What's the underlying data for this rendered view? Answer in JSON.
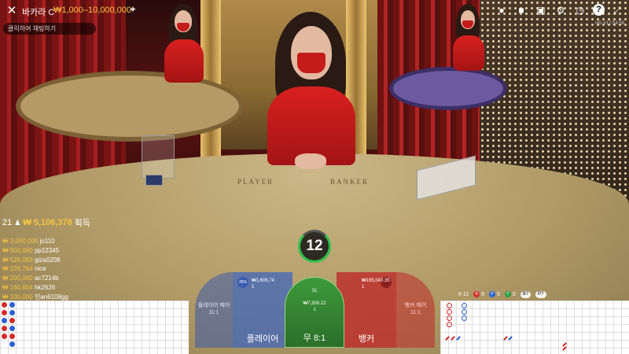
{
  "header": {
    "table_name": "바카라 C",
    "limits": "₩1,000–10,000,000",
    "chat_placeholder": "클릭하여 채팅하기",
    "round_info": "HD  #12:54:58"
  },
  "top_icons": [
    "chips-icon",
    "video-icon",
    "camera-icon",
    "gear-icon",
    "history-icon",
    "help-icon",
    "fullscreen-icon"
  ],
  "winners": {
    "count": "21",
    "total": "₩ 5,106,378",
    "suffix": "획득",
    "list": [
      {
        "amount": "₩ 3,000,000",
        "name": "jo110"
      },
      {
        "amount": "₩ 600,000",
        "name": "pp12345"
      },
      {
        "amount": "₩ 526,093",
        "name": "giza0208"
      },
      {
        "amount": "₩ 226,764",
        "name": "nice"
      },
      {
        "amount": "₩ 200,000",
        "name": "ac7214b"
      },
      {
        "amount": "₩ 160,604",
        "name": "hk2626"
      },
      {
        "amount": "₩ 100,000",
        "name": "인an6108gg"
      }
    ]
  },
  "timer": "12",
  "table_text": {
    "player": "PLAYER",
    "banker": "BANKER"
  },
  "bets": {
    "player_pair": {
      "label": "플레이어 페어",
      "payout": "11:1"
    },
    "player": {
      "label": "플레이어",
      "pct": "35%",
      "amount": "₩1,606,74",
      "count": "1"
    },
    "tie": {
      "label": "무 8:1",
      "pct": "31",
      "amount": "₩7,300.22",
      "count": "1"
    },
    "banker": {
      "label": "뱅커",
      "pct": "",
      "amount": "₩195,043.35",
      "count": "1"
    },
    "banker_pair": {
      "label": "뱅커 페어",
      "payout": "11:1"
    }
  },
  "stats": {
    "round": "# 11",
    "banker": "6",
    "player": "5",
    "tie": "0",
    "banker_ask": "B?",
    "player_ask": "P?"
  },
  "colors": {
    "banker": "#d42a2a",
    "player": "#2a62d4",
    "tie": "#2fa04a",
    "accent": "#f5c542"
  }
}
